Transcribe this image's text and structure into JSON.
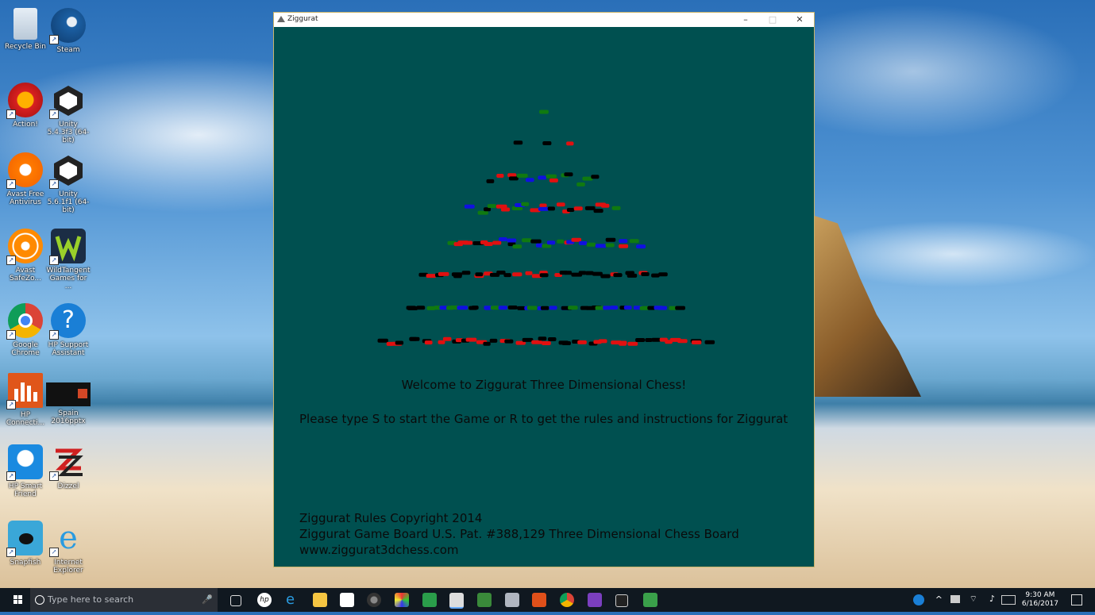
{
  "desktop_icons": [
    {
      "label": "Recycle Bin",
      "icon": "recycle-bin-icon"
    },
    {
      "label": "Steam",
      "icon": "steam-icon"
    },
    {
      "label": "Action!",
      "icon": "action-icon"
    },
    {
      "label": "Unity 5.4.3f3 (64-bit)",
      "icon": "unity-icon"
    },
    {
      "label": "Avast Free Antivirus",
      "icon": "avast-icon"
    },
    {
      "label": "Unity 5.6.1f1 (64-bit)",
      "icon": "unity-icon"
    },
    {
      "label": "Avast SafeZo...",
      "icon": "avast-safezone-icon"
    },
    {
      "label": "WildTangent Games for ...",
      "icon": "wildtangent-icon"
    },
    {
      "label": "Google Chrome",
      "icon": "chrome-icon"
    },
    {
      "label": "HP Support Assistant",
      "icon": "help-icon"
    },
    {
      "label": "HP Connecti...",
      "icon": "hp-connection-icon"
    },
    {
      "label": "Spain 2016pptx",
      "icon": "powerpoint-file-icon"
    },
    {
      "label": "HP Smart Friend",
      "icon": "hp-smart-friend-icon"
    },
    {
      "label": "Dizzel",
      "icon": "dizzel-icon"
    },
    {
      "label": "Snapfish",
      "icon": "snapfish-icon"
    },
    {
      "label": "Internet Explorer",
      "icon": "internet-explorer-icon"
    }
  ],
  "window": {
    "title": "Ziggurat",
    "controls": {
      "minimize": "–",
      "maximize": "□",
      "close": "✕"
    },
    "welcome": "Welcome to Ziggurat Three Dimensional Chess!",
    "prompt": "Please type S to start the Game or R to get the rules and instructions for Ziggurat",
    "footer": {
      "line1": "Ziggurat Rules Copyright 2014",
      "line2": "Ziggurat Game Board U.S. Pat. #388,129 Three Dimensional Chess Board",
      "line3": "www.ziggurat3dchess.com"
    },
    "colors": {
      "background": "#005050",
      "red": "#e01010",
      "black": "#000000",
      "blue": "#1010e0",
      "green": "#107a10"
    }
  },
  "taskbar": {
    "search_placeholder": "Type here to search",
    "apps": [
      "task-view-icon",
      "hp-icon",
      "edge-icon",
      "file-explorer-icon",
      "store-icon",
      "camera-icon",
      "paint-icon",
      "calculator-icon",
      "ziggurat-icon",
      "photos-icon",
      "mail-icon",
      "office-icon",
      "chrome-icon",
      "visual-studio-icon",
      "unity-icon",
      "android-icon"
    ],
    "time": "9:30 AM",
    "date": "6/16/2017"
  }
}
